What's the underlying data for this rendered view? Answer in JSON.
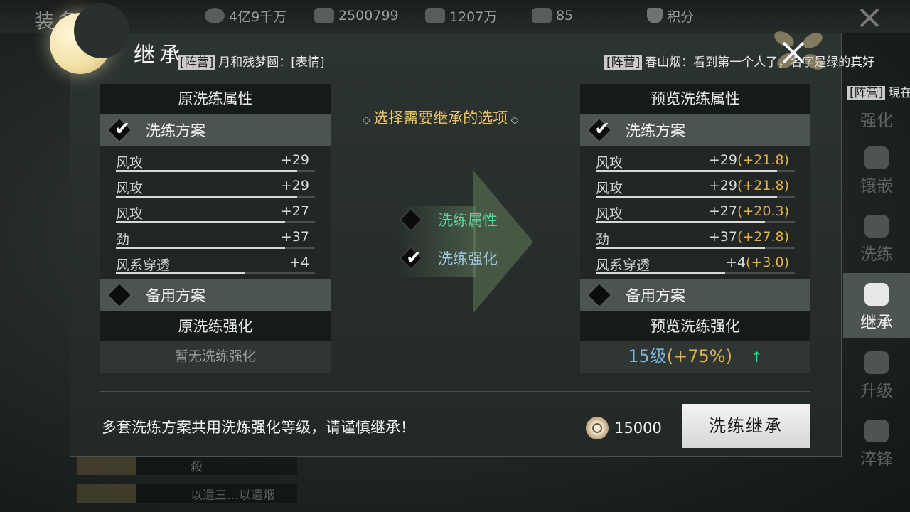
{
  "top": {
    "title": "装备",
    "resources": [
      {
        "icon": "coin-stack-icon",
        "value": "4亿9千万"
      },
      {
        "icon": "bag-icon",
        "value": "2500799"
      },
      {
        "icon": "feather-icon",
        "value": "1207万"
      },
      {
        "icon": "bag-icon",
        "value": "85"
      },
      {
        "icon": "shield-icon",
        "value": "积分"
      }
    ]
  },
  "dialog": {
    "title": "继承",
    "chat": [
      {
        "tag": "[阵营]",
        "text": "月和残梦圆：[表情]"
      },
      {
        "tag": "[阵营]",
        "text": "春山烟：看到第一个人了，名字是绿的真好"
      },
      {
        "tag": "[阵营]",
        "text": "現在"
      }
    ],
    "left": {
      "header": "原洗练属性",
      "plan_label": "洗练方案",
      "attributes": [
        {
          "name": "风攻",
          "value": "+29",
          "fill": 0.91
        },
        {
          "name": "风攻",
          "value": "+29",
          "fill": 0.91
        },
        {
          "name": "风攻",
          "value": "+27",
          "fill": 0.85
        },
        {
          "name": "劲",
          "value": "+37",
          "fill": 0.85
        },
        {
          "name": "风系穿透",
          "value": "+4",
          "fill": 0.65
        }
      ],
      "backup_label": "备用方案",
      "strength_header": "原洗练强化",
      "strength_value": "暂无洗练强化"
    },
    "center": {
      "prompt": "选择需要继承的选项",
      "option1": "洗练属性",
      "option2": "洗练强化"
    },
    "right": {
      "header": "预览洗练属性",
      "plan_label": "洗练方案",
      "attributes": [
        {
          "name": "风攻",
          "value": "+29",
          "bonus": "(+21.8)",
          "fill": 0.91
        },
        {
          "name": "风攻",
          "value": "+29",
          "bonus": "(+21.8)",
          "fill": 0.91
        },
        {
          "name": "风攻",
          "value": "+27",
          "bonus": "(+20.3)",
          "fill": 0.85
        },
        {
          "name": "劲",
          "value": "+37",
          "bonus": "(+27.8)",
          "fill": 0.85
        },
        {
          "name": "风系穿透",
          "value": "+4",
          "bonus": "(+3.0)",
          "fill": 0.65
        }
      ],
      "backup_label": "备用方案",
      "strength_header": "预览洗练强化",
      "strength_level": "15级",
      "strength_pct": "(+75%)",
      "strength_up": "↑"
    },
    "footer": {
      "warning": "多套洗炼方案共用洗炼强化等级，请谨慎继承！",
      "cost": "15000",
      "button": "洗练继承"
    }
  },
  "sidebar": {
    "items": [
      {
        "label": "强化",
        "icon": "hammer-icon"
      },
      {
        "label": "镶嵌",
        "icon": "gem-icon"
      },
      {
        "label": "洗练",
        "icon": "refresh-icon"
      },
      {
        "label": "继承",
        "icon": "inherit-icon"
      },
      {
        "label": "升级",
        "icon": "upgrade-icon"
      },
      {
        "label": "淬锋",
        "icon": "flame-icon"
      }
    ],
    "active": "继承"
  },
  "background": {
    "row1": "殺",
    "row2": "以遣三…以遣烟"
  }
}
